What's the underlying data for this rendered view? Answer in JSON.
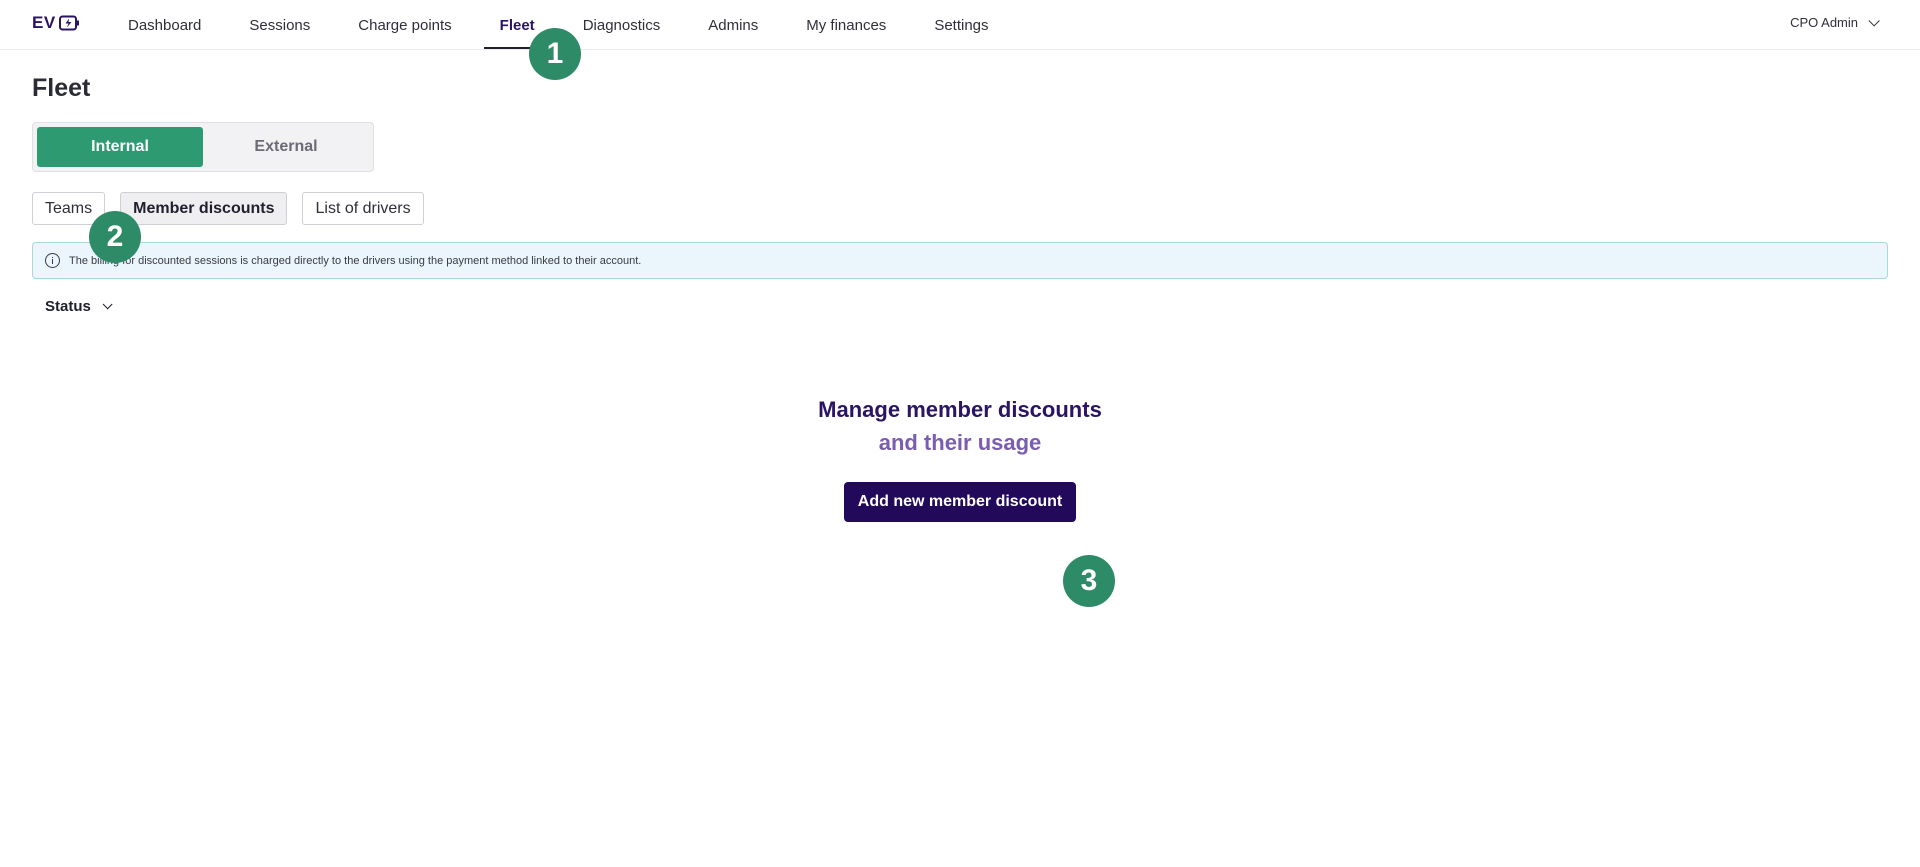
{
  "brand": {
    "logo_text": "EV"
  },
  "nav": {
    "items": [
      {
        "label": "Dashboard"
      },
      {
        "label": "Sessions"
      },
      {
        "label": "Charge points"
      },
      {
        "label": "Fleet"
      },
      {
        "label": "Diagnostics"
      },
      {
        "label": "Admins"
      },
      {
        "label": "My finances"
      },
      {
        "label": "Settings"
      }
    ],
    "active": "Fleet",
    "user": "CPO Admin"
  },
  "page": {
    "title": "Fleet"
  },
  "segmented": {
    "options": [
      "Internal",
      "External"
    ],
    "active": "Internal"
  },
  "subtabs": {
    "items": [
      "Teams",
      "Member discounts",
      "List of drivers"
    ],
    "active": "Member discounts"
  },
  "banner": {
    "icon": "info-icon",
    "text": "The billing for discounted sessions is charged directly to the drivers using the payment method linked to their account."
  },
  "filter": {
    "label": "Status"
  },
  "empty_state": {
    "title_line1": "Manage member discounts",
    "title_line2": "and their usage",
    "button_label": "Add new member discount"
  },
  "markers": [
    "1",
    "2",
    "3"
  ],
  "colors": {
    "brand_dark": "#23095a",
    "accent_green": "#2e9a72",
    "marker_green": "#2e8b68",
    "banner_bg": "#eaf6fb"
  }
}
